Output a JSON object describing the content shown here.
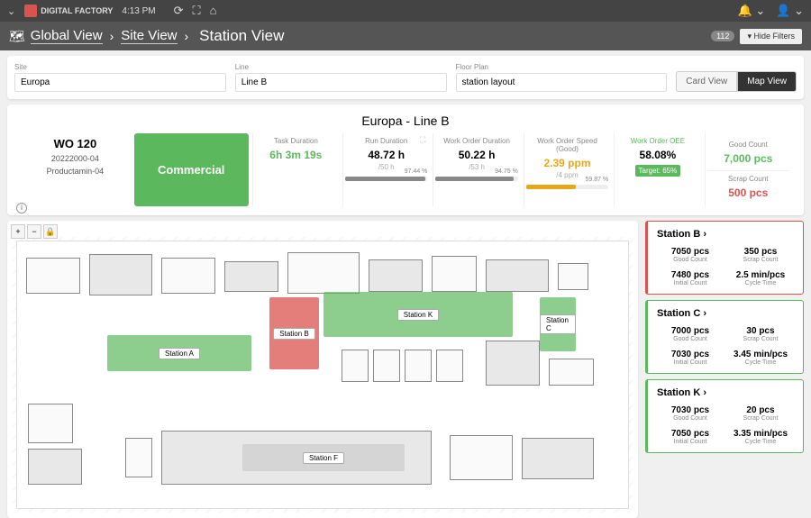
{
  "topbar": {
    "brand": "DIGITAL FACTORY",
    "time": "4:13 PM"
  },
  "breadcrumb": {
    "global": "Global View",
    "site": "Site View",
    "station": "Station View",
    "count": "112",
    "hide_filters": "Hide Filters"
  },
  "filters": {
    "site_label": "Site",
    "site_value": "Europa",
    "line_label": "Line",
    "line_value": "Line B",
    "floor_label": "Floor Plan",
    "floor_value": "station layout",
    "card_view": "Card View",
    "map_view": "Map View"
  },
  "metrics": {
    "title": "Europa - Line B",
    "wo": {
      "title": "WO 120",
      "sub1": "20222000-04",
      "sub2": "Productamin-04"
    },
    "commercial": "Commercial",
    "task": {
      "label": "Task Duration",
      "value": "6h 3m 19s"
    },
    "run": {
      "label": "Run Duration",
      "value": "48.72 h",
      "sub": "/50 h",
      "pct": "97.44 %"
    },
    "wod": {
      "label": "Work Order Duration",
      "value": "50.22 h",
      "sub": "/53 h",
      "pct": "94.75 %"
    },
    "speed": {
      "label": "Work Order Speed (Good)",
      "value": "2.39 ppm",
      "sub": "/4 ppm",
      "pct": "59.87 %"
    },
    "oee": {
      "label": "Work Order OEE",
      "value": "58.08%",
      "target": "Target: 65%"
    },
    "good": {
      "label": "Good Count",
      "value": "7,000 pcs"
    },
    "scrap": {
      "label": "Scrap Count",
      "value": "500 pcs"
    }
  },
  "map": {
    "stations": {
      "a": "Station A",
      "b": "Station B",
      "c": "Station C",
      "k": "Station K",
      "f": "Station F"
    }
  },
  "cards": [
    {
      "name": "Station B",
      "border": "red-b",
      "good_v": "7050 pcs",
      "good_l": "Good Count",
      "scrap_v": "350 pcs",
      "scrap_l": "Scrap Count",
      "init_v": "7480 pcs",
      "init_l": "Initial Count",
      "cyc_v": "2.5 min/pcs",
      "cyc_l": "Cycle Time"
    },
    {
      "name": "Station C",
      "border": "green-b",
      "good_v": "7000 pcs",
      "good_l": "Good Count",
      "scrap_v": "30 pcs",
      "scrap_l": "Scrap Count",
      "init_v": "7030 pcs",
      "init_l": "Initial Count",
      "cyc_v": "3.45 min/pcs",
      "cyc_l": "Cycle Time"
    },
    {
      "name": "Station K",
      "border": "green-b",
      "good_v": "7030 pcs",
      "good_l": "Good Count",
      "scrap_v": "20 pcs",
      "scrap_l": "Scrap Count",
      "init_v": "7050 pcs",
      "init_l": "Initial Count",
      "cyc_v": "3.35 min/pcs",
      "cyc_l": "Cycle Time"
    }
  ]
}
